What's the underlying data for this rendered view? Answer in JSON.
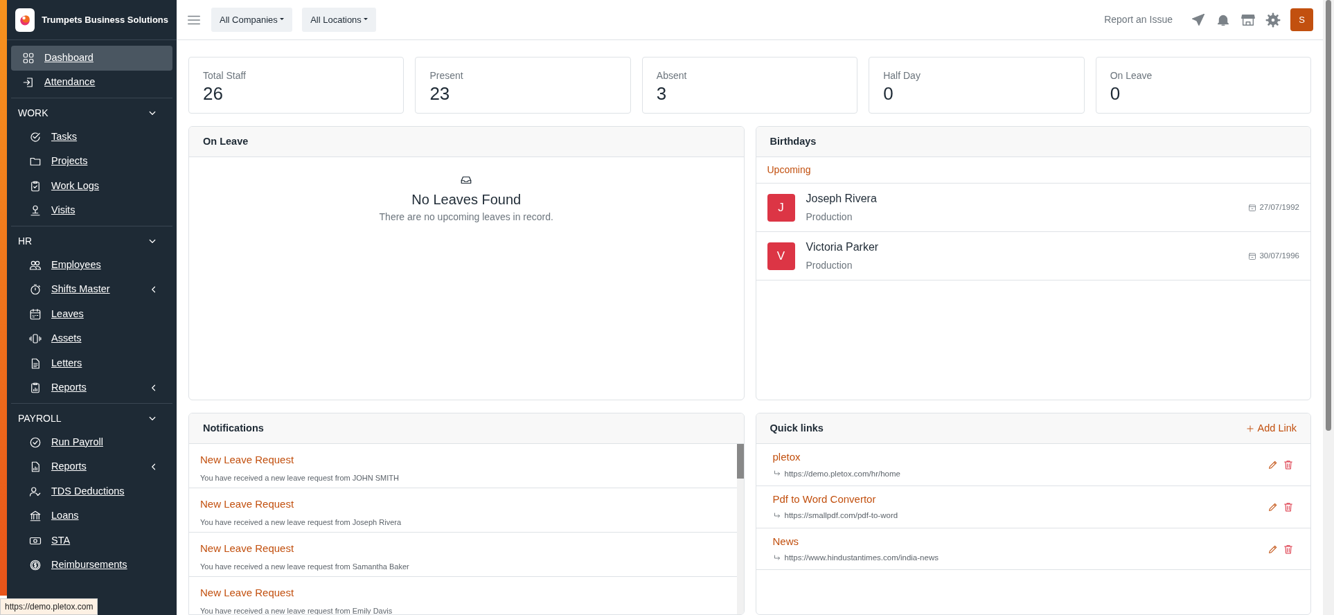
{
  "brand": {
    "name": "Trumpets Business Solutions"
  },
  "sidebar": {
    "items": [
      {
        "label": "Dashboard",
        "selected": true
      },
      {
        "label": "Attendance",
        "selected": false
      }
    ],
    "sections": [
      {
        "title": "WORK",
        "expanded": true,
        "items": [
          {
            "label": "Tasks",
            "selected": false,
            "has_submenu": false
          },
          {
            "label": "Projects",
            "selected": false,
            "has_submenu": false
          },
          {
            "label": "Work Logs",
            "selected": false,
            "has_submenu": false
          },
          {
            "label": "Visits",
            "selected": false,
            "has_submenu": false
          }
        ]
      },
      {
        "title": "HR",
        "expanded": true,
        "items": [
          {
            "label": "Employees",
            "selected": false,
            "has_submenu": false
          },
          {
            "label": "Shifts Master",
            "selected": false,
            "has_submenu": true
          },
          {
            "label": "Leaves",
            "selected": false,
            "has_submenu": false
          },
          {
            "label": "Assets",
            "selected": false,
            "has_submenu": false
          },
          {
            "label": "Letters",
            "selected": false,
            "has_submenu": false
          },
          {
            "label": "Reports",
            "selected": false,
            "has_submenu": true
          }
        ]
      },
      {
        "title": "PAYROLL",
        "expanded": true,
        "items": [
          {
            "label": "Run Payroll",
            "selected": false,
            "has_submenu": false
          },
          {
            "label": "Reports",
            "selected": false,
            "has_submenu": true
          },
          {
            "label": "TDS Deductions",
            "selected": false,
            "has_submenu": false
          },
          {
            "label": "Loans",
            "selected": false,
            "has_submenu": false
          },
          {
            "label": "STA",
            "selected": false,
            "has_submenu": false
          },
          {
            "label": "Reimbursements",
            "selected": false,
            "has_submenu": false
          }
        ]
      }
    ]
  },
  "status_link": "https://demo.pletox.com",
  "topbar": {
    "filters": [
      "All Companies",
      "All Locations"
    ],
    "report": "Report an Issue",
    "avatar": "S"
  },
  "stats": [
    {
      "label": "Total Staff",
      "value": "26"
    },
    {
      "label": "Present",
      "value": "23"
    },
    {
      "label": "Absent",
      "value": "3"
    },
    {
      "label": "Half Day",
      "value": "0"
    },
    {
      "label": "On Leave",
      "value": "0"
    }
  ],
  "on_leave": {
    "title": "On Leave",
    "empty_title": "No Leaves Found",
    "empty_text": "There are no upcoming leaves in record."
  },
  "birthdays": {
    "title": "Birthdays",
    "tab": "Upcoming",
    "people": [
      {
        "initial": "J",
        "name": "Joseph Rivera",
        "department": "Production",
        "date": "27/07/1992"
      },
      {
        "initial": "V",
        "name": "Victoria Parker",
        "department": "Production",
        "date": "30/07/1996"
      }
    ]
  },
  "notifications": {
    "title": "Notifications",
    "items": [
      {
        "title": "New Leave Request",
        "text": "You have received a new leave request from JOHN SMITH"
      },
      {
        "title": "New Leave Request",
        "text": "You have received a new leave request from Joseph Rivera"
      },
      {
        "title": "New Leave Request",
        "text": "You have received a new leave request from Samantha Baker"
      },
      {
        "title": "New Leave Request",
        "text": "You have received a new leave request from Emily Davis"
      }
    ]
  },
  "quick_links": {
    "title": "Quick links",
    "add": "Add Link",
    "links": [
      {
        "name": "pletox",
        "url": "https://demo.pletox.com/hr/home"
      },
      {
        "name": "Pdf to Word Convertor",
        "url": "https://smallpdf.com/pdf-to-word"
      },
      {
        "name": "News",
        "url": "https://www.hindustantimes.com/india-news"
      }
    ]
  }
}
